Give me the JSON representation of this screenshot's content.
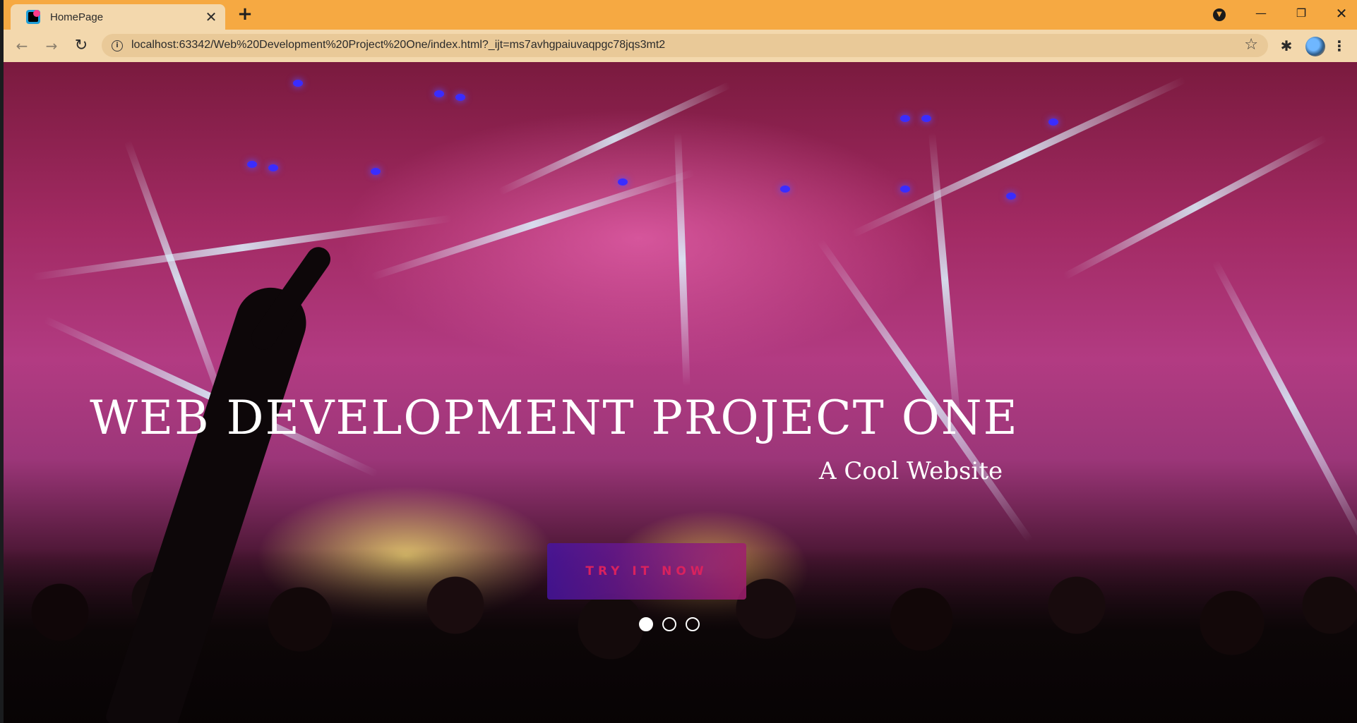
{
  "browser": {
    "tab": {
      "title": "HomePage",
      "close_glyph": "✕"
    },
    "new_tab_glyph": "+",
    "window_controls": {
      "minimize": "—",
      "maximize": "❐",
      "close": "✕"
    },
    "toolbar": {
      "back_glyph": "←",
      "forward_glyph": "→",
      "reload_glyph": "↻",
      "url": "localhost:63342/Web%20Development%20Project%20One/index.html?_ijt=ms7avhgpaiuvaqpgc78jqs3mt2",
      "star_glyph": "☆",
      "extensions_glyph": "✱",
      "menu_glyph": "⋮"
    },
    "colors": {
      "frame": "#f6a942",
      "toolbar": "#f3d8ad",
      "omnibox": "#e9c998"
    }
  },
  "hero": {
    "title": "WEB DEVELOPMENT PROJECT ONE",
    "subtitle": "A Cool Website",
    "cta_label": "TRY IT NOW",
    "carousel": {
      "slides": 3,
      "active_index": 0
    }
  }
}
